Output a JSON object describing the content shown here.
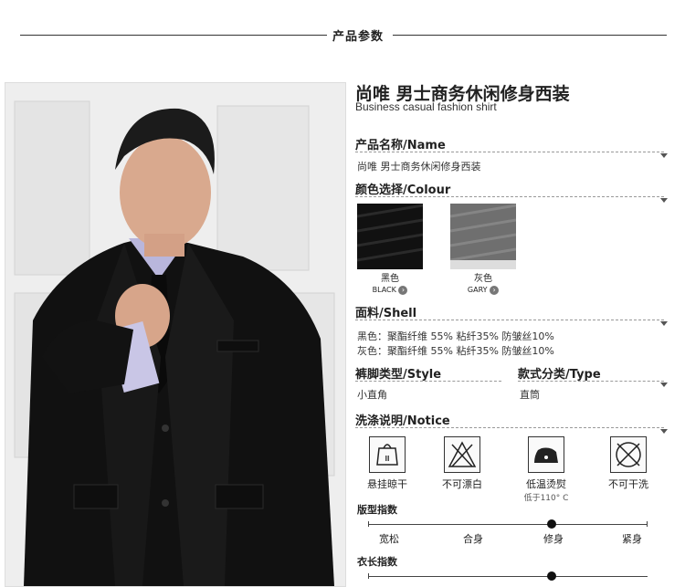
{
  "header": {
    "title": "产品参数"
  },
  "product": {
    "title": "尚唯 男士商务休闲修身西装",
    "subtitle": "Business casual fashion shirt"
  },
  "sections": {
    "name": {
      "label": "产品名称/Name",
      "value": "尚唯 男士商务休闲修身西装"
    },
    "colour": {
      "label": "颜色选择/Colour"
    },
    "shell": {
      "label": "面料/Shell",
      "line1": "黑色：聚酯纤维 55% 粘纤35% 防皱丝10%",
      "line2": "灰色：聚酯纤维 55% 粘纤35% 防皱丝10%"
    },
    "style": {
      "label": "裤脚类型/Style",
      "value": "小直角"
    },
    "type": {
      "label": "款式分类/Type",
      "value": "直筒"
    },
    "notice": {
      "label": "洗涤说明/Notice"
    }
  },
  "colors": [
    {
      "cn": "黑色",
      "en": "BLACK",
      "hex": "#111111"
    },
    {
      "cn": "灰色",
      "en": "GARY",
      "hex": "#6f6f6f"
    }
  ],
  "care": [
    {
      "label": "悬挂晾干",
      "icon": "hang-dry-icon"
    },
    {
      "label": "不可漂白",
      "icon": "no-bleach-icon"
    },
    {
      "label": "低温烫熨",
      "note": "低于110° C",
      "icon": "low-iron-icon"
    },
    {
      "label": "不可干洗",
      "icon": "no-dry-clean-icon"
    }
  ],
  "fit": {
    "label": "版型指数",
    "options": [
      "宽松",
      "合身",
      "修身",
      "紧身"
    ],
    "selected_index": 2
  },
  "length": {
    "label": "衣长指数",
    "options": [
      "",
      "",
      "",
      ""
    ],
    "selected_index": 2
  }
}
